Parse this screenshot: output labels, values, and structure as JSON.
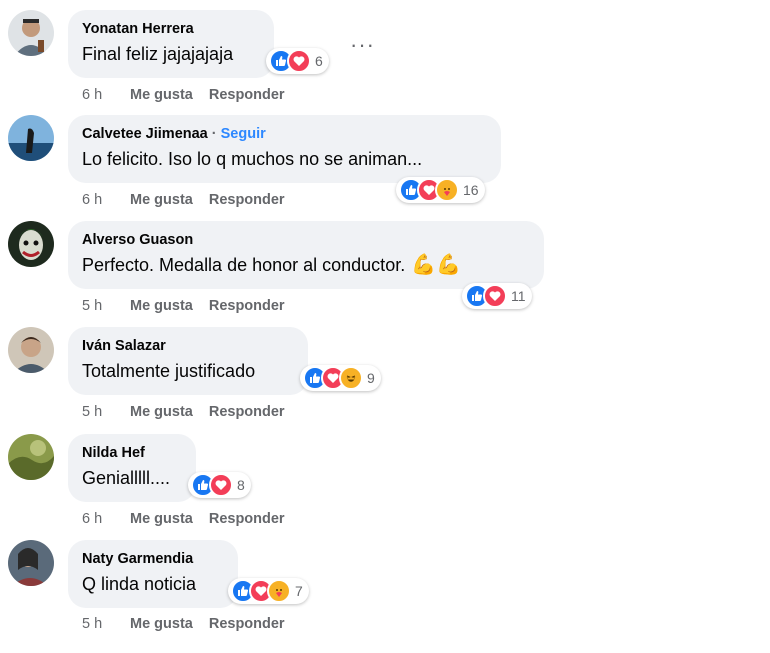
{
  "comments": [
    {
      "author": "Yonatan Herrera",
      "text": "Final feliz jajajajaja",
      "reactions": [
        "like",
        "love"
      ],
      "count": "6",
      "time": "6 h",
      "like_label": "Me gusta",
      "reply_label": "Responder",
      "avatar_color": "#b9c2c4"
    },
    {
      "author": "Calvetee Jiimenaa",
      "follow": "Seguir",
      "text": "Lo felicito. Iso lo q muchos no se animan...",
      "reactions": [
        "like",
        "love",
        "care"
      ],
      "count": "16",
      "time": "6 h",
      "like_label": "Me gusta",
      "reply_label": "Responder",
      "avatar_color": "#4a7fb0"
    },
    {
      "author": "Alverso Guason",
      "text": "Perfecto. Medalla de honor al conductor.",
      "emoji_trailing": "💪💪",
      "reactions": [
        "like",
        "love"
      ],
      "count": "11",
      "time": "5 h",
      "like_label": "Me gusta",
      "reply_label": "Responder",
      "avatar_color": "#3a4a3a"
    },
    {
      "author": "Iván Salazar",
      "text": "Totalmente justificado",
      "reactions": [
        "like",
        "love",
        "haha"
      ],
      "count": "9",
      "time": "5 h",
      "like_label": "Me gusta",
      "reply_label": "Responder",
      "avatar_color": "#9a8a7a"
    },
    {
      "author": "Nilda Hef",
      "text": "Genialllll....",
      "reactions": [
        "like",
        "love"
      ],
      "count": "8",
      "time": "6 h",
      "like_label": "Me gusta",
      "reply_label": "Responder",
      "avatar_color": "#7a8a3a"
    },
    {
      "author": "Naty Garmendia",
      "text": "Q linda noticia",
      "reactions": [
        "like",
        "love",
        "care"
      ],
      "count": "7",
      "time": "5 h",
      "like_label": "Me gusta",
      "reply_label": "Responder",
      "avatar_color": "#4a5a6a"
    }
  ],
  "more_menu": "···",
  "colors": {
    "like": "#1877f2",
    "love": "#f33e58",
    "care": "#f7b125",
    "haha": "#f7b125",
    "bubble": "#f0f2f5",
    "meta": "#65676b",
    "follow": "#2d88ff"
  }
}
